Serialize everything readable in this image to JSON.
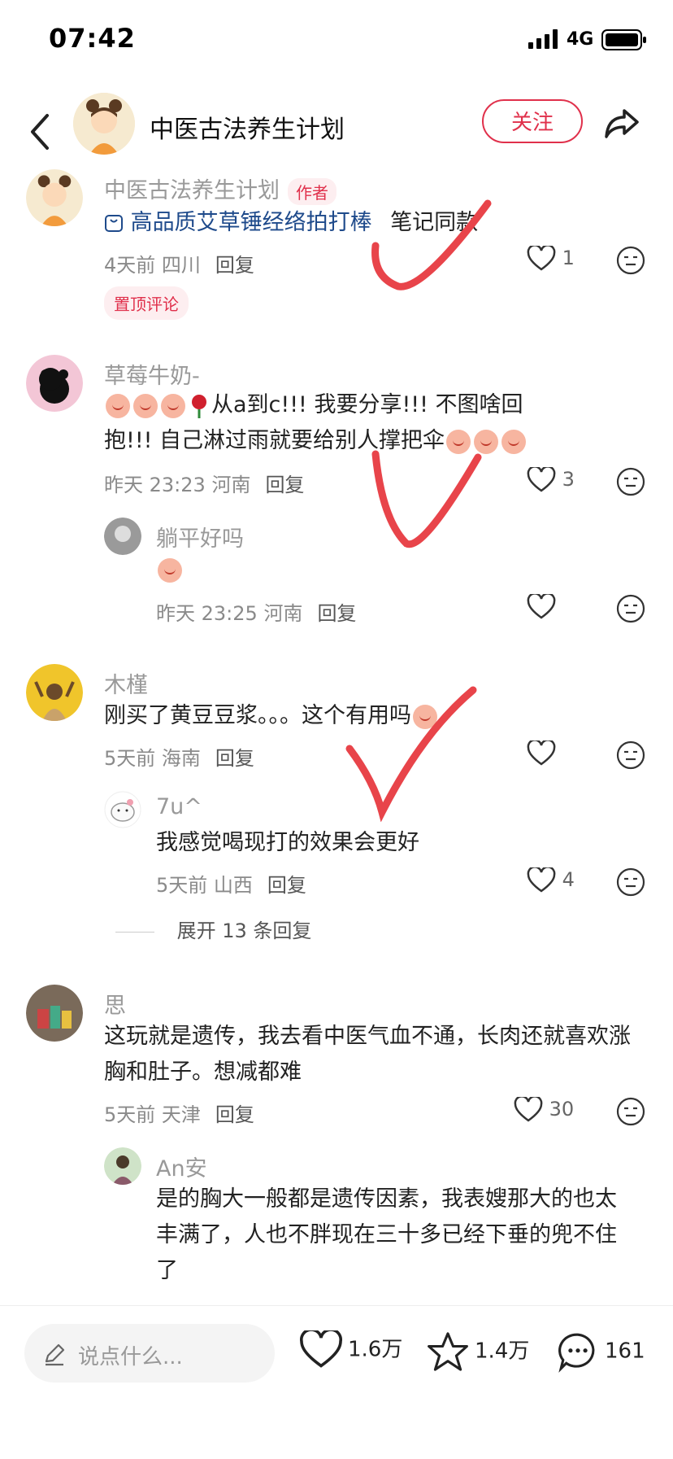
{
  "status": {
    "time": "07:42",
    "network": "4G"
  },
  "header": {
    "title": "中医古法养生计划",
    "follow_label": "关注"
  },
  "comments": [
    {
      "user": "中医古法养生计划",
      "author_badge": "作者",
      "product_link": "高品质艾草锤经络拍打棒",
      "text_suffix": "笔记同款",
      "time": "4天前",
      "location": "四川",
      "reply_label": "回复",
      "likes": "1",
      "pinned_label": "置顶评论"
    },
    {
      "user": "草莓牛奶-",
      "text_line1": "从a到c!!!  我要分享!!!  不图啥回",
      "text_line2": "抱!!!  自己淋过雨就要给别人撑把伞",
      "time": "昨天 23:23",
      "location": "河南",
      "reply_label": "回复",
      "likes": "3",
      "replies": [
        {
          "user": "躺平好吗",
          "time": "昨天 23:25",
          "location": "河南",
          "reply_label": "回复",
          "likes": ""
        }
      ]
    },
    {
      "user": "木槿",
      "text": "刚买了黄豆豆浆。。。这个有用吗",
      "time": "5天前",
      "location": "海南",
      "reply_label": "回复",
      "likes": "",
      "replies": [
        {
          "user": "7u^",
          "text": "我感觉喝现打的效果会更好",
          "time": "5天前",
          "location": "山西",
          "reply_label": "回复",
          "likes": "4"
        }
      ],
      "expand_label": "展开 13 条回复"
    },
    {
      "user": "思",
      "text_line1": "这玩就是遗传，我去看中医气血不通，长肉还就喜欢涨",
      "text_line2": "胸和肚子。想减都难",
      "time": "5天前",
      "location": "天津",
      "reply_label": "回复",
      "likes": "30",
      "replies": [
        {
          "user": "An安",
          "text_line1": "是的胸大一般都是遗传因素，我表嫂那大的也太",
          "text_line2": "丰满了，人也不胖现在三十多已经下垂的兜不住",
          "text_line3": "了"
        }
      ]
    }
  ],
  "bottom": {
    "input_placeholder": "说点什么...",
    "likes": "1.6万",
    "favorites": "1.4万",
    "comments": "161"
  },
  "colors": {
    "accent": "#e0304b",
    "annotation": "#e8444a"
  }
}
